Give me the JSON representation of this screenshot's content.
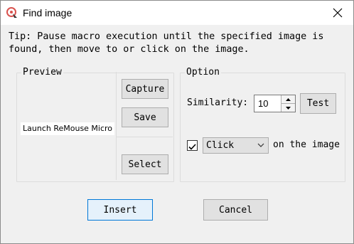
{
  "window": {
    "title": "Find image"
  },
  "tip": "Tip: Pause macro execution until the specified image is found, then move to or click on the image.",
  "preview": {
    "label": "Preview",
    "captured_text": "Launch ReMouse Micro",
    "capture_label": "Capture",
    "save_label": "Save",
    "select_label": "Select"
  },
  "option": {
    "label": "Option",
    "similarity_label": "Similarity:",
    "similarity_value": "10",
    "test_label": "Test",
    "click_checked": true,
    "action_value": "Click",
    "action_suffix": "on the image"
  },
  "footer": {
    "insert_label": "Insert",
    "cancel_label": "Cancel"
  },
  "colors": {
    "accent": "#0078d7",
    "icon_red": "#d9534f"
  },
  "icons": [
    "app-icon",
    "close-icon",
    "spin-up-icon",
    "spin-down-icon",
    "check-icon",
    "chevron-down-icon"
  ]
}
